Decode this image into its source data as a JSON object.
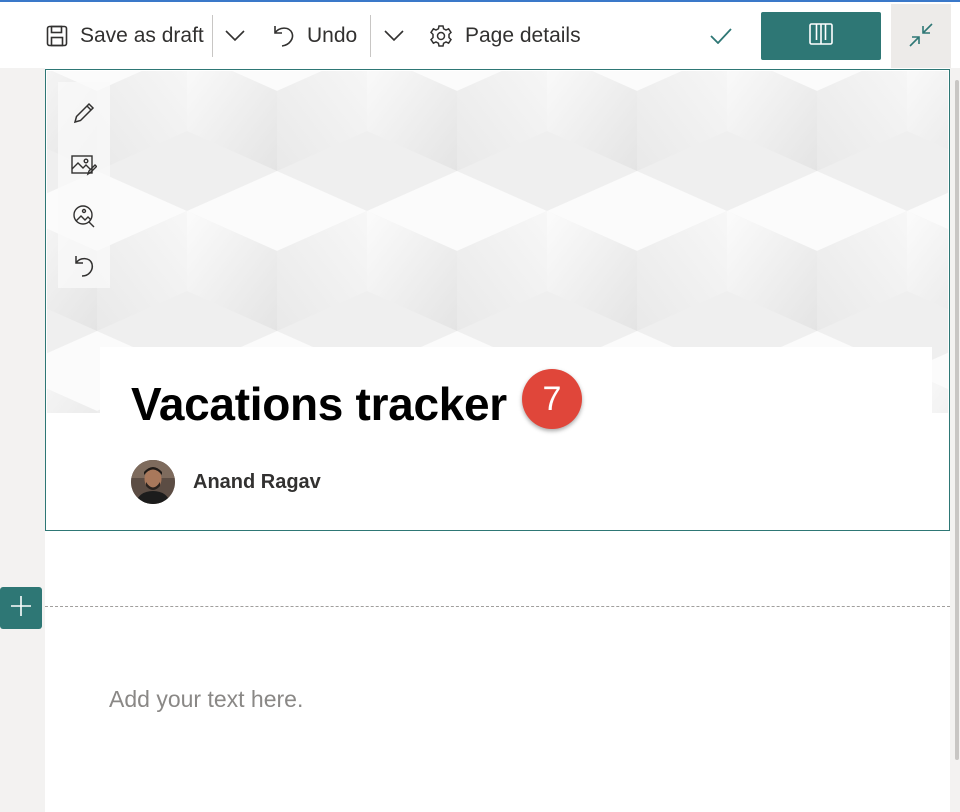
{
  "commandbar": {
    "save_label": "Save as draft",
    "undo_label": "Undo",
    "page_details_label": "Page details"
  },
  "title_region": {
    "title": "Vacations tracker",
    "step_badge": "7",
    "author_name": "Anand Ragav"
  },
  "canvas": {
    "text_placeholder": "Add your text here."
  },
  "colors": {
    "accent": "#2e7775",
    "badge": "#e0463a",
    "top_border": "#3a78c9"
  },
  "icons": {
    "save": "save-icon",
    "undo": "undo-icon",
    "page_details": "gear-icon",
    "check": "check-icon",
    "reading_view": "book-icon",
    "collapse": "collapse-icon",
    "edit": "pencil-icon",
    "image": "image-edit-icon",
    "focal_point": "focal-point-icon",
    "reset": "reset-icon",
    "add_section": "plus-icon"
  }
}
